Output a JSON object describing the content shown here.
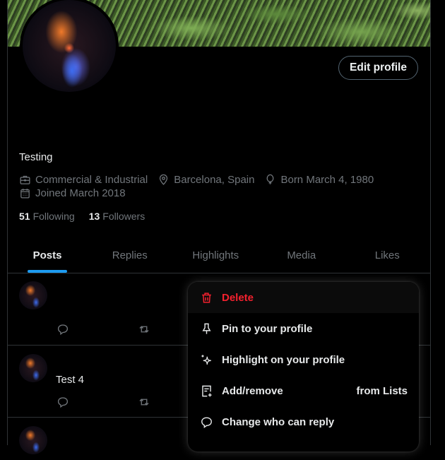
{
  "profile": {
    "edit_button": "Edit profile",
    "bio": "Testing",
    "category": "Commercial & Industrial",
    "location": "Barcelona, Spain",
    "birthday": "Born March 4, 1980",
    "joined": "Joined March 2018",
    "following_count": "51",
    "following_label": "Following",
    "followers_count": "13",
    "followers_label": "Followers",
    "icons": {
      "category": "briefcase-icon",
      "location": "map-pin-icon",
      "birthday": "balloon-icon",
      "joined": "calendar-icon"
    }
  },
  "tabs": [
    {
      "label": "Posts",
      "active": true
    },
    {
      "label": "Replies",
      "active": false
    },
    {
      "label": "Highlights",
      "active": false
    },
    {
      "label": "Media",
      "active": false
    },
    {
      "label": "Likes",
      "active": false
    }
  ],
  "posts": [
    {
      "text": ""
    },
    {
      "text": "Test 4"
    },
    {
      "text": ""
    }
  ],
  "post_actions": [
    "reply-icon",
    "repost-icon"
  ],
  "context_menu": {
    "items": [
      {
        "label": "Delete",
        "icon": "trash-icon",
        "danger": true
      },
      {
        "label": "Pin to your profile",
        "icon": "pin-icon"
      },
      {
        "label": "Highlight on your profile",
        "icon": "sparkle-icon"
      },
      {
        "label": "Add/remove",
        "label_right": "from Lists",
        "icon": "list-add-icon"
      },
      {
        "label": "Change who can reply",
        "icon": "speech-bubble-icon"
      }
    ]
  },
  "colors": {
    "accent": "#1d9bf0",
    "danger": "#f4212e",
    "muted_text": "#71767b",
    "border": "#2f3336"
  }
}
